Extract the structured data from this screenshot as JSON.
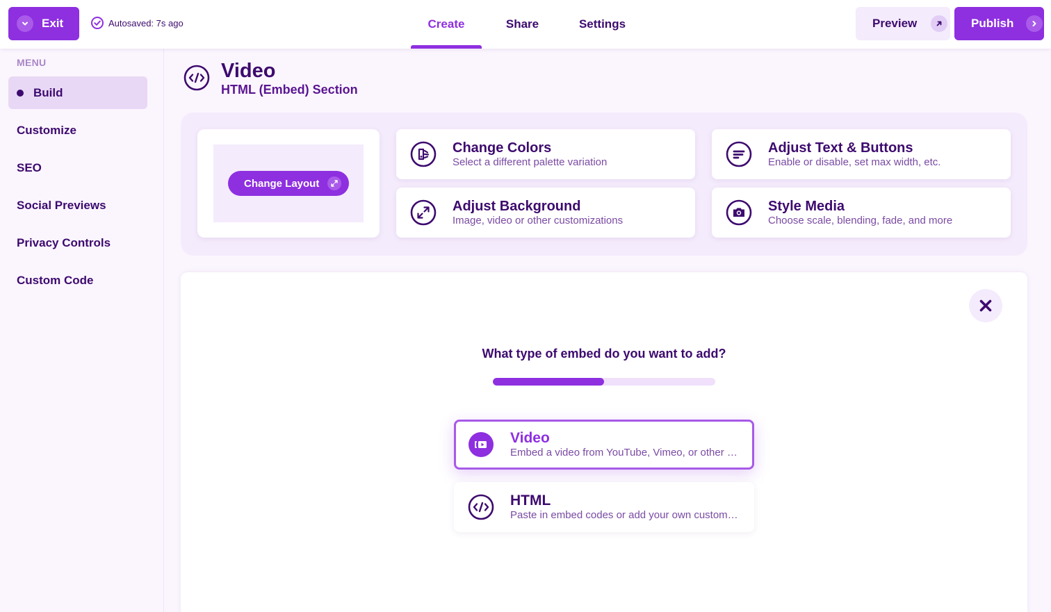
{
  "topbar": {
    "exit_label": "Exit",
    "autosave_label": "Autosaved: 7s ago",
    "tabs": [
      {
        "label": "Create",
        "active": true
      },
      {
        "label": "Share",
        "active": false
      },
      {
        "label": "Settings",
        "active": false
      }
    ],
    "preview_label": "Preview",
    "publish_label": "Publish"
  },
  "sidebar": {
    "menu_label": "MENU",
    "items": [
      {
        "label": "Build",
        "active": true
      },
      {
        "label": "Customize",
        "active": false
      },
      {
        "label": "SEO",
        "active": false
      },
      {
        "label": "Social Previews",
        "active": false
      },
      {
        "label": "Privacy Controls",
        "active": false
      },
      {
        "label": "Custom Code",
        "active": false
      }
    ]
  },
  "section": {
    "icon": "code-embed-icon",
    "title": "Video",
    "subtitle": "HTML (Embed) Section"
  },
  "options": {
    "change_layout_label": "Change Layout",
    "cards": [
      {
        "icon": "palette-icon",
        "title": "Change Colors",
        "desc": "Select a different palette variation"
      },
      {
        "icon": "text-buttons-icon",
        "title": "Adjust Text & Buttons",
        "desc": "Enable or disable, set max width, etc."
      },
      {
        "icon": "expand-background-icon",
        "title": "Adjust Background",
        "desc": "Image, video or other customizations"
      },
      {
        "icon": "camera-icon",
        "title": "Style Media",
        "desc": "Choose scale, blending, fade, and more"
      }
    ]
  },
  "embed": {
    "question": "What type of embed do you want to add?",
    "progress": 0.5,
    "choices": [
      {
        "icon": "video-camera-icon",
        "title": "Video",
        "desc": "Embed a video from YouTube, Vimeo, or other providers",
        "selected": true
      },
      {
        "icon": "code-embed-icon",
        "title": "HTML",
        "desc": "Paste in embed codes or add your own custom HTML",
        "selected": false
      }
    ]
  },
  "colors": {
    "accent": "#8e2fe0",
    "text": "#3d0a6e",
    "panel": "#f4ebfc"
  }
}
